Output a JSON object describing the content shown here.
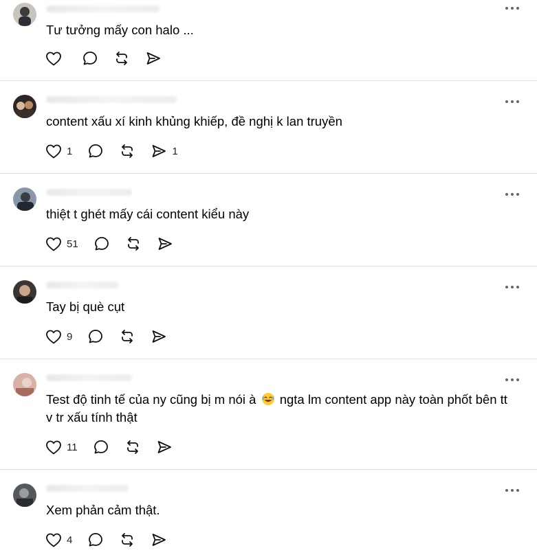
{
  "icons": {
    "like": "heart-icon",
    "reply": "comment-icon",
    "repost": "repost-icon",
    "share": "send-icon",
    "more": "more-options-icon",
    "emoji": "laughing-emoji"
  },
  "posts": [
    {
      "text": "Tư tưởng mấy con halo ...",
      "likes": "",
      "shares": ""
    },
    {
      "text": "content xấu xí kinh khủng khiếp, đề nghị k lan truyền",
      "likes": "1",
      "shares": "1"
    },
    {
      "text": "thiệt t ghét mấy cái content kiểu này",
      "likes": "51",
      "shares": ""
    },
    {
      "text": "Tay bị què cụt",
      "likes": "9",
      "shares": ""
    },
    {
      "text_before_emoji": "Test độ tinh tế của ny cũng bị m nói à ",
      "text_after_emoji": " ngta lm content app này toàn phốt bên tt v tr xấu tính thật",
      "likes": "11",
      "shares": ""
    },
    {
      "text": "Xem phản cảm thật.",
      "likes": "4",
      "shares": ""
    }
  ]
}
